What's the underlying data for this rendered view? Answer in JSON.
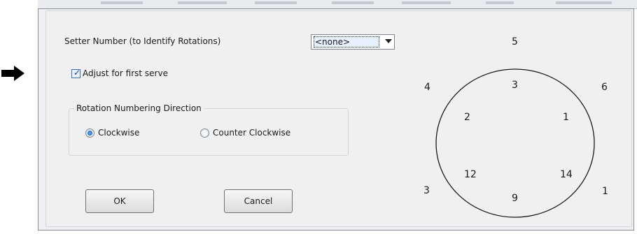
{
  "dialog": {
    "setter_label": "Setter Number (to Identify Rotations)",
    "setter_value": "<none>",
    "adjust_label": "Adjust for first serve",
    "adjust_checked": true,
    "group_title": "Rotation Numbering Direction",
    "radio_clockwise": "Clockwise",
    "radio_counter": "Counter Clockwise",
    "selected_direction": "Clockwise",
    "ok_label": "OK",
    "cancel_label": "Cancel"
  },
  "court": {
    "outer_numbers": [
      "5",
      "6",
      "1",
      "3",
      "4"
    ],
    "inner_numbers": [
      "3",
      "1",
      "14",
      "9",
      "12",
      "2"
    ]
  },
  "colors": {
    "dialog_bg": "#f0f0f0",
    "radio_selected": "#1a64c8",
    "checkbox": "#3b6fb6"
  }
}
